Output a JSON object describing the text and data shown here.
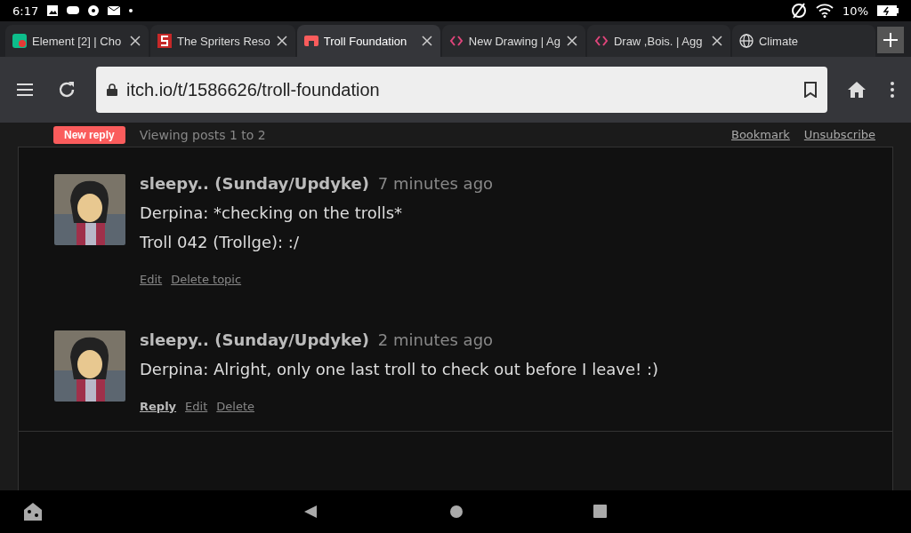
{
  "status_bar": {
    "time": "6:17",
    "battery": "10%"
  },
  "tabs": [
    {
      "title": "Element [2] | Cho",
      "kind": "element",
      "selected": false
    },
    {
      "title": "The Spriters Reso",
      "kind": "spriters",
      "selected": false
    },
    {
      "title": "Troll Foundation",
      "kind": "store",
      "selected": true
    },
    {
      "title": "New Drawing | Ag",
      "kind": "code",
      "selected": false
    },
    {
      "title": "Draw ,Bois. | Agg",
      "kind": "code",
      "selected": false
    },
    {
      "title": "Climate",
      "kind": "web",
      "selected": false
    }
  ],
  "address_bar": {
    "url": "itch.io/t/1586626/troll-foundation"
  },
  "topic_bar": {
    "new_reply": "New reply",
    "viewing": "Viewing posts 1 to 2",
    "links": [
      "Bookmark",
      "Unsubscribe"
    ]
  },
  "posts": [
    {
      "author": "sleepy.. (Sunday/Updyke)",
      "time": "7 minutes ago",
      "paragraphs": [
        "Derpina: *checking on the trolls*",
        "Troll 042 (Trollge): :/"
      ],
      "actions": [
        {
          "label": "Edit",
          "primary": false
        },
        {
          "label": "Delete topic",
          "primary": false
        }
      ]
    },
    {
      "author": "sleepy.. (Sunday/Updyke)",
      "time": "2 minutes ago",
      "paragraphs": [
        "Derpina: Alright, only one last troll to check out before I leave! :)"
      ],
      "actions": [
        {
          "label": "Reply",
          "primary": true
        },
        {
          "label": "Edit",
          "primary": false
        },
        {
          "label": "Delete",
          "primary": false
        }
      ]
    }
  ]
}
